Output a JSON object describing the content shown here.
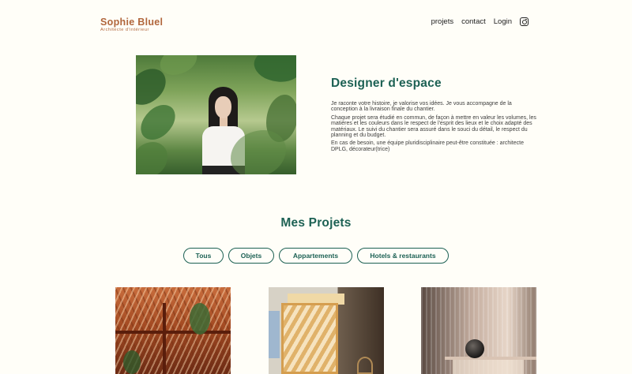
{
  "header": {
    "logo_title": "Sophie Bluel",
    "logo_subtitle": "Architecte d'intérieur",
    "nav": {
      "projets": "projets",
      "contact": "contact",
      "login": "Login",
      "instagram_icon": "instagram-icon"
    }
  },
  "intro": {
    "title": "Designer d'espace",
    "paragraphs": [
      "Je raconte votre histoire, je valorise vos idées. Je vous accompagne de la conception à la livraison finale du chantier.",
      "Chaque projet sera étudié en commun, de façon à mettre en valeur les volumes, les matières et les couleurs dans le respect de l'esprit des lieux et le choix adapté des matériaux. Le suivi du chantier sera assuré dans le souci du détail, le respect du planning et du budget.",
      "En cas de besoin, une équipe pluridisciplinaire peut-être constituée : architecte DPLG, décorateur(trice)"
    ]
  },
  "projects": {
    "title": "Mes Projets",
    "filters": [
      "Tous",
      "Objets",
      "Appartements",
      "Hotels & restaurants"
    ]
  },
  "colors": {
    "background": "#FFFEF8",
    "accent_green": "#1D6154",
    "logo_orange": "#B1663C"
  }
}
